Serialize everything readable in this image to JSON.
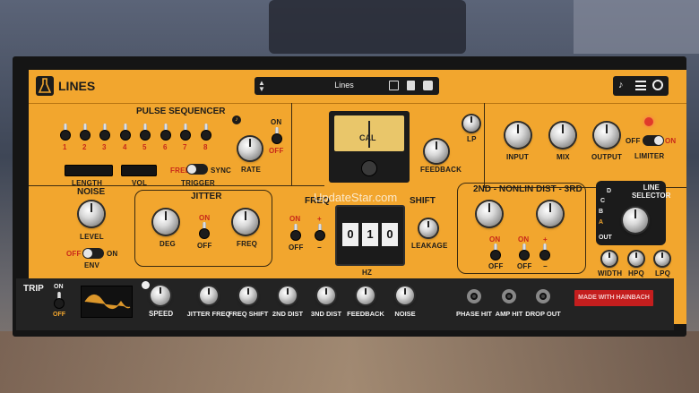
{
  "header": {
    "app_name": "LINES",
    "preset_name": "Lines",
    "icons": [
      "lab-flask-icon",
      "arrows-updown-icon",
      "save-icon",
      "trash-icon",
      "dice-icon",
      "bell-icon",
      "menu-icon",
      "power-icon"
    ]
  },
  "pulse_sequencer": {
    "title": "PULSE SEQUENCER",
    "steps": [
      "1",
      "2",
      "3",
      "4",
      "5",
      "6",
      "7",
      "8"
    ],
    "length_label": "LENGTH",
    "vol_label": "VOL",
    "trigger_label": "TRIGGER",
    "free_label": "FREE",
    "sync_label": "SYNC",
    "rate_label": "RATE",
    "on_label": "ON",
    "off_label": "OFF"
  },
  "meter": {
    "label": "CAL"
  },
  "filter": {
    "feedback_label": "FEEDBACK",
    "lp_label": "LP"
  },
  "output": {
    "input_label": "INPUT",
    "mix_label": "MIX",
    "output_label": "OUTPUT",
    "limiter_label": "LIMITER",
    "off_label": "OFF",
    "on_label": "ON"
  },
  "noise": {
    "title": "NOISE",
    "level_label": "LEVEL",
    "env_label": "ENV",
    "off_label": "OFF",
    "on_label": "ON"
  },
  "jitter": {
    "title": "JITTER",
    "deg_label": "DEG",
    "freq_label": "FREQ",
    "on_label": "ON",
    "off_label": "OFF"
  },
  "freq_shift": {
    "title_left": "FREQ",
    "title_right": "SHIFT",
    "on_label": "ON",
    "off_label": "OFF",
    "plus_label": "+",
    "minus_label": "−",
    "hz_label": "HZ",
    "leakage_label": "LEAKAGE",
    "digits": [
      "0",
      "1",
      "0"
    ]
  },
  "dist": {
    "title": "2ND - NONLIN DIST - 3RD",
    "on_label": "ON",
    "off_label": "OFF",
    "plus_label": "+",
    "minus_label": "−"
  },
  "line_selector": {
    "title_line1": "LINE",
    "title_line2": "SELECTOR",
    "positions": [
      "D",
      "C",
      "B",
      "A"
    ],
    "selected": "A",
    "out_label": "OUT",
    "width_label": "WIDTH",
    "hpq_label": "HPQ",
    "lpq_label": "LPQ"
  },
  "watermark": "UpdateStar.com",
  "bottom": {
    "trip_label": "TRIP",
    "on_label": "ON",
    "off_label": "OFF",
    "speed_label": "SPEED",
    "knobs": [
      "JITTER FREQ",
      "FREQ SHIFT",
      "2ND DIST",
      "3ND DIST",
      "FEEDBACK",
      "NOISE"
    ],
    "jacks": [
      "PHASE HIT",
      "AMP HIT",
      "DROP OUT"
    ],
    "made_with": "MADE WITH HAINBACH"
  },
  "colors": {
    "panel": "#f2a62e",
    "accent_red": "#c8281a",
    "frame": "#151515"
  }
}
